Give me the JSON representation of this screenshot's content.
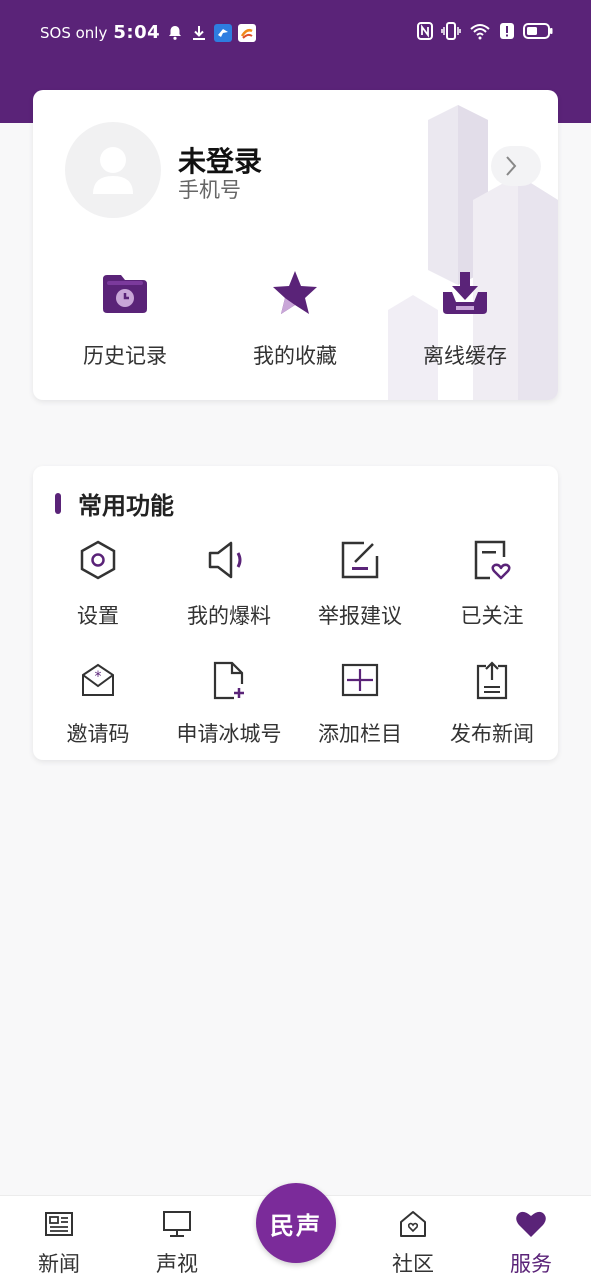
{
  "colors": {
    "brand": "#5a2378",
    "accent": "#7b2b9a",
    "background": "#f8f8f9"
  },
  "status_bar": {
    "carrier": "SOS only",
    "time": "5:04",
    "icons_left": [
      "bell-icon",
      "download-icon",
      "app-bird-icon",
      "app-orange-icon"
    ],
    "icons_right": [
      "nfc-icon",
      "vibrate-icon",
      "wifi-icon",
      "alert-icon",
      "battery-icon"
    ]
  },
  "profile": {
    "title": "未登录",
    "subtitle": "手机号"
  },
  "quick_actions": [
    {
      "label": "历史记录",
      "icon": "history-folder-icon"
    },
    {
      "label": "我的收藏",
      "icon": "star-icon"
    },
    {
      "label": "离线缓存",
      "icon": "download-tray-icon"
    }
  ],
  "functions": {
    "title": "常用功能",
    "items": [
      {
        "label": "设置",
        "icon": "settings-hexagon-icon"
      },
      {
        "label": "我的爆料",
        "icon": "speaker-icon"
      },
      {
        "label": "举报建议",
        "icon": "edit-report-icon"
      },
      {
        "label": "已关注",
        "icon": "followed-heart-icon"
      },
      {
        "label": "邀请码",
        "icon": "invite-envelope-icon"
      },
      {
        "label": "申请冰城号",
        "icon": "apply-document-icon"
      },
      {
        "label": "添加栏目",
        "icon": "add-column-icon"
      },
      {
        "label": "发布新闻",
        "icon": "publish-upload-icon"
      }
    ]
  },
  "bottom_nav": {
    "items": [
      {
        "label": "新闻",
        "icon": "newspaper-icon"
      },
      {
        "label": "声视",
        "icon": "monitor-icon"
      },
      {
        "label": "社区",
        "icon": "community-home-icon"
      },
      {
        "label": "服务",
        "icon": "heart-icon",
        "active": true
      }
    ],
    "center_label": "民声"
  }
}
